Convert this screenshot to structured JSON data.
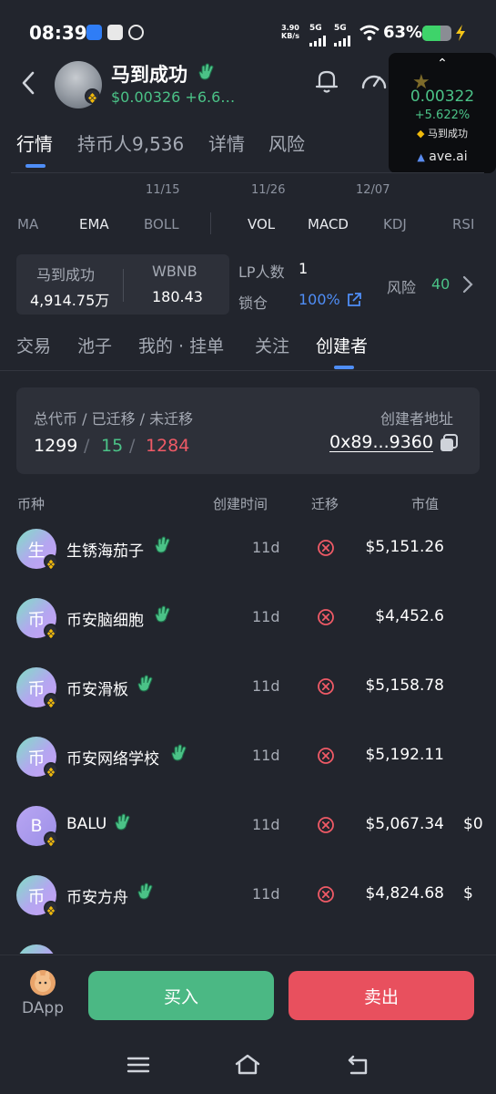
{
  "status_bar": {
    "time": "08:39",
    "net_speed_value": "3.90",
    "net_speed_unit": "KB/s",
    "sim1": "5G",
    "sim2": "5G",
    "battery_pct": "63%",
    "battery_level": 0.63
  },
  "header": {
    "token_name": "马到成功",
    "price_line": "$0.00326 +6.6…"
  },
  "ave_widget": {
    "price": "0.00322",
    "change": "+5.622%",
    "token_name": "马到成功",
    "brand": "ave.ai"
  },
  "main_tabs": [
    {
      "label": "行情",
      "active": true
    },
    {
      "label": "持币人9,536",
      "active": false
    },
    {
      "label": "详情",
      "active": false
    },
    {
      "label": "风险",
      "active": false
    }
  ],
  "chart_dates": [
    "11/15",
    "11/26",
    "12/07"
  ],
  "indicators_left": [
    {
      "label": "MA",
      "active": false
    },
    {
      "label": "EMA",
      "active": true
    },
    {
      "label": "BOLL",
      "active": false
    }
  ],
  "indicators_right": [
    {
      "label": "VOL",
      "active": true
    },
    {
      "label": "MACD",
      "active": true
    },
    {
      "label": "KDJ",
      "active": false
    },
    {
      "label": "RSI",
      "active": false
    }
  ],
  "stats": {
    "token_label": "马到成功",
    "token_amount": "4,914.75万",
    "pair_label": "WBNB",
    "pair_amount": "180.43",
    "lp_label": "LP人数",
    "lp_value": "1",
    "lock_label": "锁仓",
    "lock_value": "100%",
    "risk_label": "风险",
    "risk_value": "40"
  },
  "sub_tabs": [
    {
      "label": "交易",
      "active": false
    },
    {
      "label": "池子",
      "active": false
    },
    {
      "label": "我的 · 挂单",
      "active": false
    },
    {
      "label": "关注",
      "active": false
    },
    {
      "label": "创建者",
      "active": true
    }
  ],
  "creator": {
    "summary_label": "总代币 / 已迁移 / 未迁移",
    "total": "1299",
    "slash": "/",
    "migrated": "15",
    "unmigrated": "1284",
    "address_label": "创建者地址",
    "address": "0x89...9360"
  },
  "table": {
    "headers": [
      "币种",
      "创建时间",
      "迁移",
      "市值"
    ],
    "rows": [
      {
        "initial": "生",
        "name": "生锈海茄子",
        "time": "11d",
        "mcap": "$5,151.26",
        "extra": ""
      },
      {
        "initial": "币",
        "name": "币安脑细胞",
        "time": "11d",
        "mcap": "$4,452.6",
        "extra": ""
      },
      {
        "initial": "币",
        "name": "币安滑板",
        "time": "11d",
        "mcap": "$5,158.78",
        "extra": ""
      },
      {
        "initial": "币",
        "name": "币安网络学校",
        "time": "11d",
        "mcap": "$5,192.11",
        "extra": ""
      },
      {
        "initial": "B",
        "name": "BALU",
        "time": "11d",
        "mcap": "$5,067.34",
        "extra": "$0"
      },
      {
        "initial": "币",
        "name": "币安方舟",
        "time": "11d",
        "mcap": "$4,824.68",
        "extra": "$"
      }
    ]
  },
  "bottom_bar": {
    "dapp_label": "DApp",
    "buy_label": "买入",
    "sell_label": "卖出"
  }
}
